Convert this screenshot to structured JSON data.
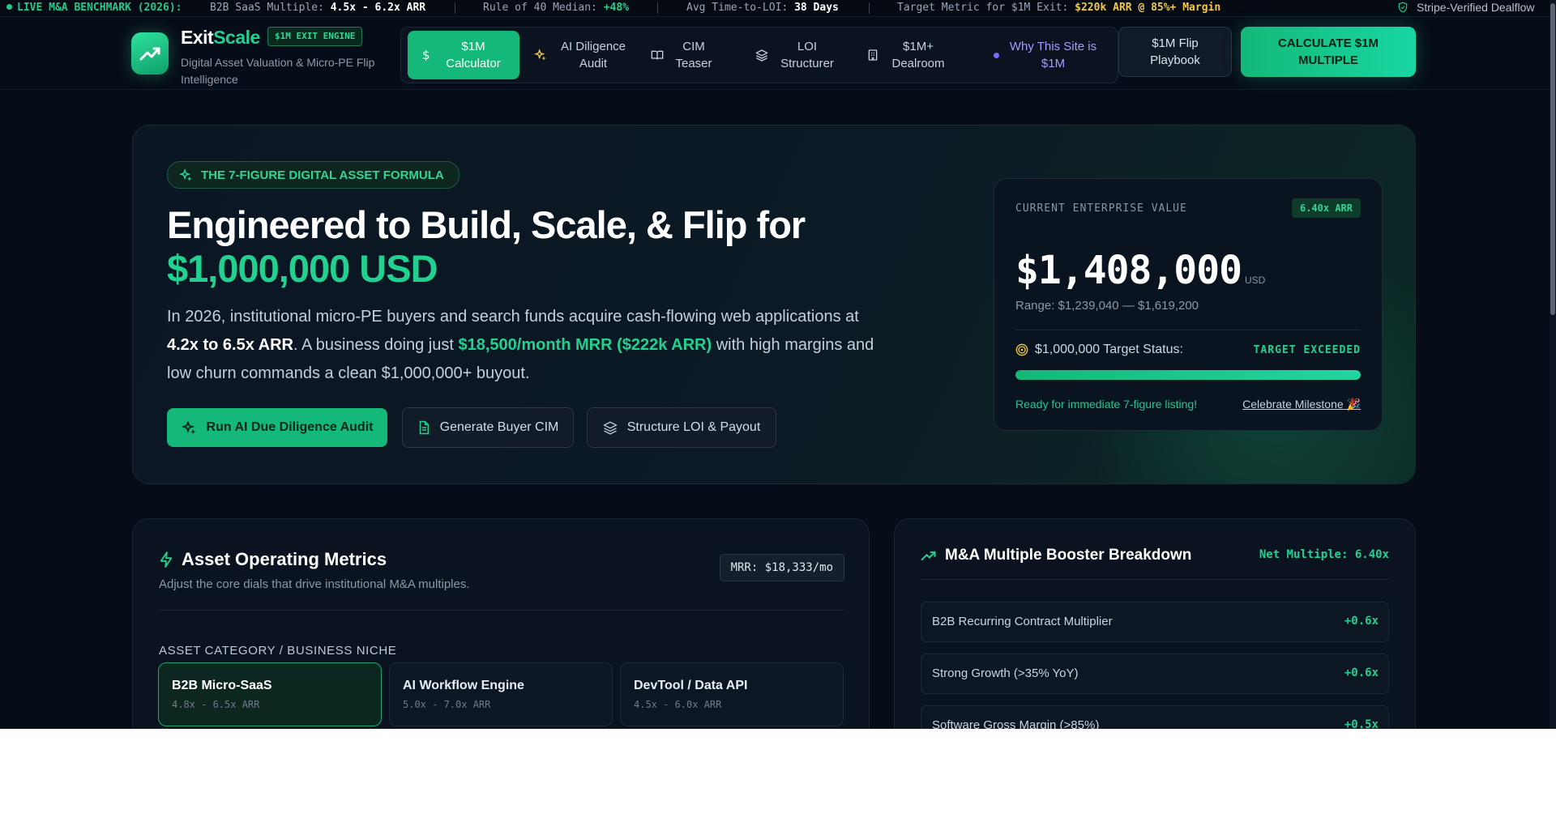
{
  "ticker": {
    "live_label": "LIVE M&A BENCHMARK (2026):",
    "saas_multiple_label": "B2B SaaS Multiple:",
    "saas_multiple_value": "4.5x - 6.2x ARR",
    "rule40_label": "Rule of 40 Median:",
    "rule40_value": "+48%",
    "loi_label": "Avg Time-to-LOI:",
    "loi_value": "38 Days",
    "target_label": "Target Metric for $1M Exit:",
    "target_value": "$220k ARR @ 85%+ Margin",
    "verified_label": "Stripe-Verified Dealflow"
  },
  "header": {
    "brand_part1": "Exit",
    "brand_part2": "Scale",
    "engine_badge": "$1M EXIT ENGINE",
    "tagline": "Digital Asset Valuation & Micro-PE Flip Intelligence",
    "nav": [
      {
        "label": "$1M Calculator",
        "icon": "dollar-icon"
      },
      {
        "label": "AI Diligence Audit",
        "icon": "sparkles-icon"
      },
      {
        "label": "CIM Teaser",
        "icon": "book-icon"
      },
      {
        "label": "LOI Structurer",
        "icon": "layers-icon"
      },
      {
        "label": "$1M+ Dealroom",
        "icon": "building-icon"
      },
      {
        "label": "Why This Site is $1M",
        "icon": "dot-icon"
      }
    ],
    "playbook_label": "$1M Flip Playbook",
    "calc_cta_label": "CALCULATE $1M MULTIPLE"
  },
  "hero": {
    "pill_label": "THE 7-FIGURE DIGITAL ASSET FORMULA",
    "title_line1": "Engineered to Build, Scale, & Flip for",
    "title_line2": "$1,000,000 USD",
    "desc_part1": "In 2026, institutional micro-PE buyers and search funds acquire cash-flowing web applications at ",
    "desc_bold": "4.2x to 6.5x ARR",
    "desc_part2": ". A business doing just ",
    "desc_highlight": "$18,500/month MRR ($222k ARR)",
    "desc_part3": " with high margins and low churn commands a clean $1,000,000+ buyout.",
    "btn_audit": "Run AI Due Diligence Audit",
    "btn_cim": "Generate Buyer CIM",
    "btn_loi": "Structure LOI & Payout"
  },
  "valuation": {
    "label": "CURRENT ENTERPRISE VALUE",
    "multiple_badge": "6.40x ARR",
    "value": "$1,408,000",
    "unit": "USD",
    "range": "Range: $1,239,040 — $1,619,200",
    "target_label": "$1,000,000 Target Status:",
    "target_status": "TARGET EXCEEDED",
    "progress_pct": 100,
    "ready_text": "Ready for immediate 7-figure listing!",
    "celebrate_label": "Celebrate Milestone 🎉"
  },
  "metrics": {
    "title": "Asset Operating Metrics",
    "subtitle": "Adjust the core dials that drive institutional M&A multiples.",
    "mrr_chip": "MRR: $18,333/mo",
    "category_label": "ASSET CATEGORY / BUSINESS NICHE",
    "categories": [
      {
        "name": "B2B Micro-SaaS",
        "range": "4.8x - 6.5x ARR"
      },
      {
        "name": "AI Workflow Engine",
        "range": "5.0x - 7.0x ARR"
      },
      {
        "name": "DevTool / Data API",
        "range": "4.5x - 6.0x ARR"
      }
    ]
  },
  "boosters": {
    "title": "M&A Multiple Booster Breakdown",
    "net_multiple": "Net Multiple: 6.40x",
    "items": [
      {
        "label": "B2B Recurring Contract Multiplier",
        "value": "+0.6x"
      },
      {
        "label": "Strong Growth (>35% YoY)",
        "value": "+0.6x"
      },
      {
        "label": "Software Gross Margin (>85%)",
        "value": "+0.5x"
      }
    ]
  },
  "colors": {
    "accent": "#22d18f",
    "background": "#070d18",
    "gold": "#f2c94c",
    "violet": "#7b6cff"
  }
}
